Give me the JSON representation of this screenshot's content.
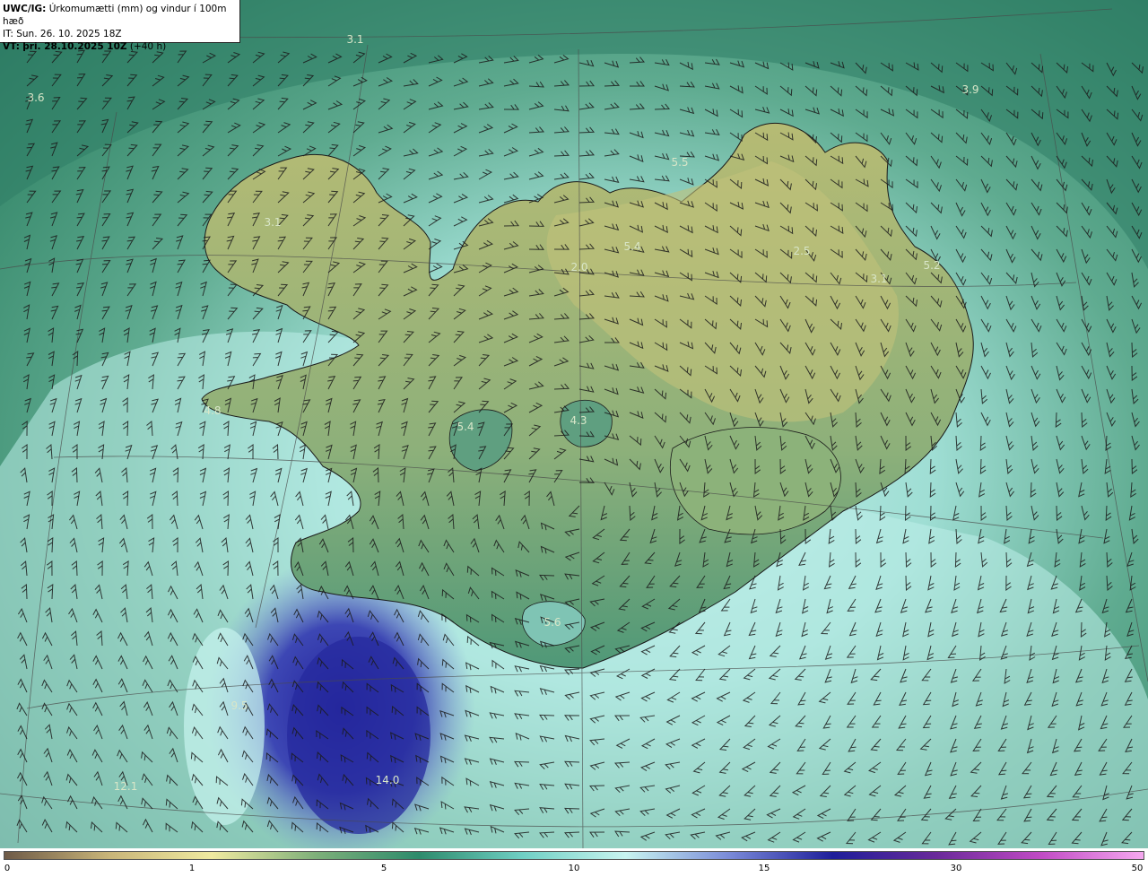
{
  "header": {
    "title_prefix": "UWC/IG:",
    "title": "Úrkomumætti (mm) og vindur í 100m hæð",
    "init_time": "IT: Sun. 26. 10. 2025 18Z",
    "valid_prefix": "VT:",
    "valid_time": "þri. 28.10.2025 10Z",
    "lead": "(+40 h)"
  },
  "map_labels": [
    "3.1",
    "3.6",
    "3.9",
    "5.5",
    "3.1",
    "5.4",
    "2.5",
    "5.2",
    "2.0",
    "3.1",
    "4.8",
    "5.4",
    "4.3",
    "5.6",
    "9.5",
    "12.1",
    "14.0"
  ],
  "colorbar": {
    "ticks": [
      "0",
      "1",
      "5",
      "10",
      "15",
      "30",
      "50"
    ],
    "colors": [
      "#6e5a47",
      "#c8b478",
      "#f0eaa0",
      "#7fb07a",
      "#2d8b6c",
      "#6fcfc4",
      "#c8f4f0",
      "#7a8ad8",
      "#1e1e9a",
      "#6a2a9a",
      "#c04ac4",
      "#f6a8f0"
    ]
  },
  "colors": {
    "land_high": "#c9c47c",
    "land_low": "#3f8c6a",
    "sea_dark": "#2c7a62",
    "sea_mid": "#5fab90",
    "sea_light": "#bff0ee",
    "heavy": "#3a3fb0",
    "heavy_core": "#22209a"
  }
}
